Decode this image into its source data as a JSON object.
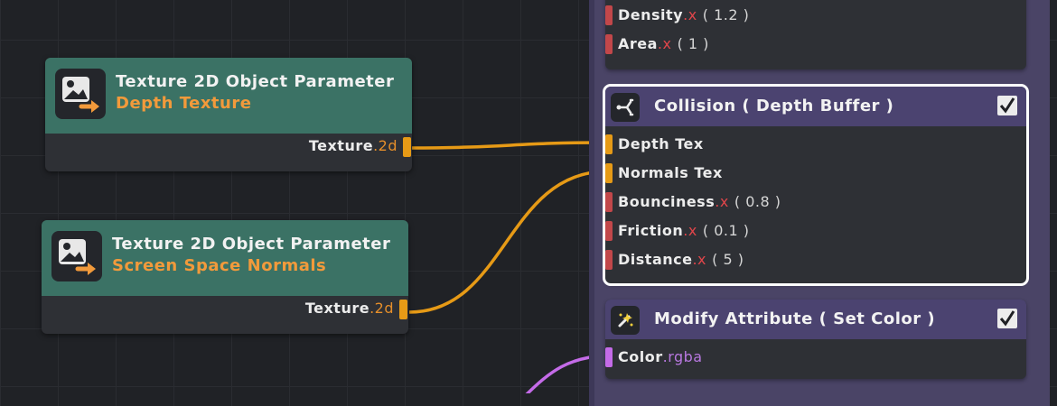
{
  "colors": {
    "background": "#202226",
    "parameter_header": "#3b7265",
    "parameter_subtitle": "#f29a3b",
    "context_header": "#4b4370",
    "texture_wire": "#e69a16",
    "color_wire": "#c46be8",
    "float_port": "#c2474a",
    "selection_outline": "#ffffff"
  },
  "param_nodes": [
    {
      "icon": "texture-parameter-icon",
      "title": "Texture 2D Object Parameter",
      "subtitle": "Depth Texture",
      "output": {
        "label": "Texture",
        "suffix": ".2d"
      }
    },
    {
      "icon": "texture-parameter-icon",
      "title": "Texture 2D Object Parameter",
      "subtitle": "Screen Space Normals",
      "output": {
        "label": "Texture",
        "suffix": ".2d"
      }
    }
  ],
  "blocks": {
    "top": {
      "slots": [
        {
          "label": "Density",
          "suffix": ".x",
          "value": "( 1.2 )"
        },
        {
          "label": "Area",
          "suffix": ".x",
          "value": "( 1 )"
        }
      ]
    },
    "collision": {
      "icon": "collision-icon",
      "title": "Collision ( Depth Buffer )",
      "enabled": true,
      "slots": [
        {
          "label": "Depth Tex",
          "suffix": "",
          "value": ""
        },
        {
          "label": "Normals Tex",
          "suffix": "",
          "value": ""
        },
        {
          "label": "Bounciness",
          "suffix": ".x",
          "value": "( 0.8 )"
        },
        {
          "label": "Friction",
          "suffix": ".x",
          "value": "( 0.1 )"
        },
        {
          "label": "Distance",
          "suffix": ".x",
          "value": "( 5 )"
        }
      ]
    },
    "modify": {
      "icon": "modify-attribute-icon",
      "title": "Modify Attribute ( Set Color )",
      "enabled": true,
      "slots": [
        {
          "label": "Color",
          "suffix": ".rgba",
          "value": ""
        }
      ]
    }
  }
}
